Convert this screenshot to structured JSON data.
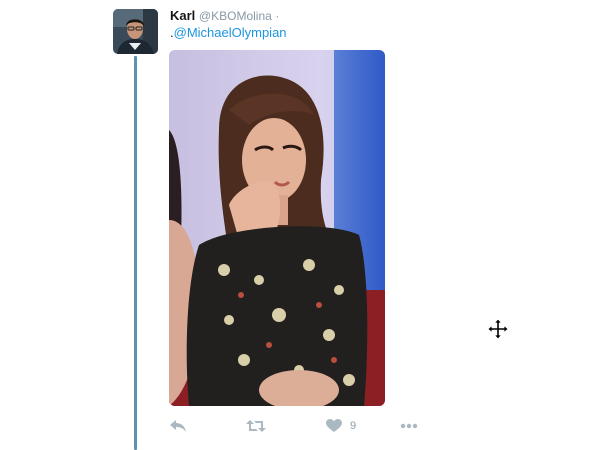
{
  "tweet": {
    "display_name": "Karl",
    "handle": "@KBOMolina",
    "separator": "·",
    "text_prefix": ".",
    "mention": "@MichaelOlympian",
    "media_alt": "GIF of a woman in a floral dress with her hand on her cheek",
    "actions": {
      "reply_icon": "reply-icon",
      "retweet_icon": "retweet-icon",
      "like_icon": "heart-icon",
      "like_count": "9",
      "more_icon": "more-dots-icon"
    }
  },
  "cursor": {
    "icon": "move-cursor-icon"
  },
  "colors": {
    "thread_line": "#5b92ad",
    "link": "#1b95e0",
    "muted": "#8899a6",
    "text": "#14171a"
  }
}
